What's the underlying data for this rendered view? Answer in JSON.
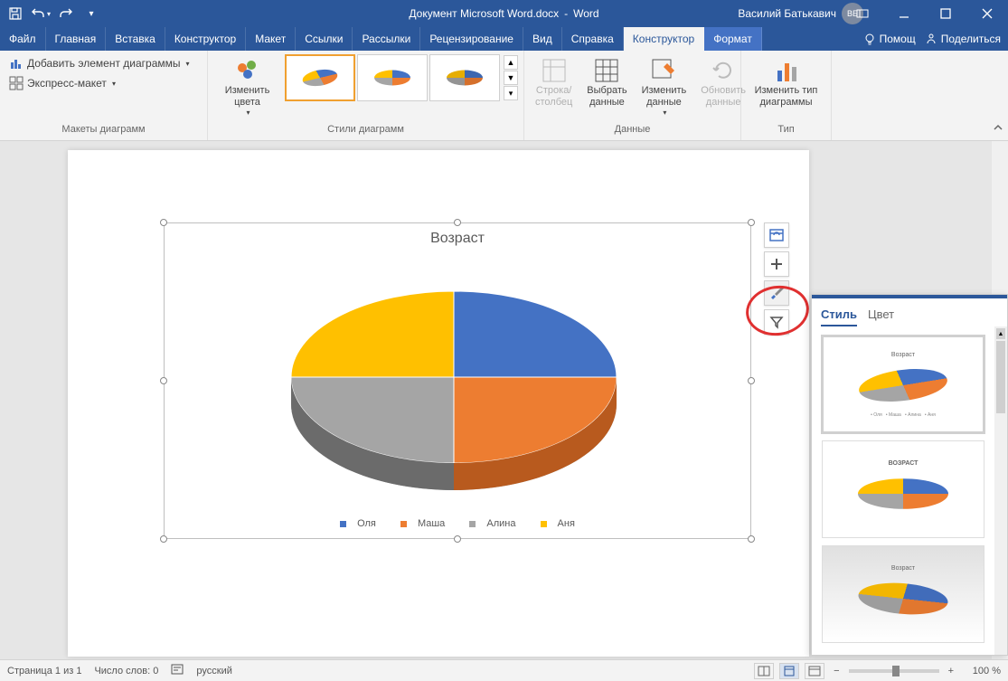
{
  "title_doc": "Документ Microsoft Word.docx",
  "title_app": "Word",
  "title_sep": " - ",
  "user_name": "Василий Батькавич",
  "user_initials": "ВБ",
  "tabs": {
    "file": "Файл",
    "home": "Главная",
    "insert": "Вставка",
    "designer": "Конструктор",
    "layout": "Макет",
    "references": "Ссылки",
    "mailings": "Рассылки",
    "review": "Рецензирование",
    "view": "Вид",
    "help": "Справка",
    "chart_design": "Конструктор",
    "chart_format": "Формат",
    "tell_me": "Помощ",
    "share": "Поделиться"
  },
  "ribbon": {
    "group_layouts": "Макеты диаграмм",
    "add_element": "Добавить элемент диаграммы",
    "quick_layout": "Экспресс-макет",
    "change_colors": "Изменить цвета",
    "group_styles": "Стили диаграмм",
    "switch_rc": "Строка/ столбец",
    "select_data": "Выбрать данные",
    "edit_data": "Изменить данные",
    "refresh_data": "Обновить данные",
    "group_data": "Данные",
    "change_type": "Изменить тип диаграммы",
    "group_type": "Тип"
  },
  "chart_data": {
    "type": "pie",
    "title": "Возраст",
    "categories": [
      "Оля",
      "Маша",
      "Алина",
      "Аня"
    ],
    "values": [
      25,
      25,
      25,
      25
    ],
    "colors": [
      "#4472c4",
      "#ed7d31",
      "#a5a5a5",
      "#ffc000"
    ]
  },
  "style_panel": {
    "tab_style": "Стиль",
    "tab_color": "Цвет",
    "thumb_titles": [
      "Возраст",
      "ВОЗРАСТ",
      "Возраст"
    ]
  },
  "status": {
    "page": "Страница 1 из 1",
    "words_label": "Число слов:",
    "words_count": "0",
    "lang": "русский",
    "zoom": "100 %"
  }
}
